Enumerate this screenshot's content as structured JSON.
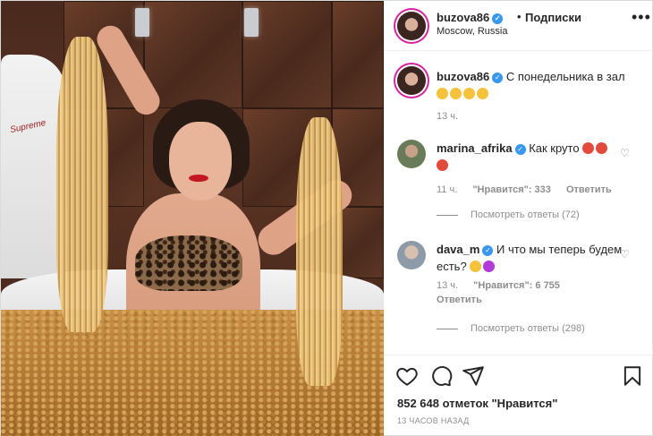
{
  "post": {
    "author": "buzova86",
    "follow_label": "Подписки",
    "location": "Moscow, Russia",
    "more_label": "•••",
    "caption": {
      "text": "С понедельника в зал",
      "time": "13 ч."
    },
    "likes_text": "852 648 отметок \"Нравится\"",
    "timestamp": "13 часов назад"
  },
  "comments": [
    {
      "username": "marina_afrika",
      "text": "Как круто",
      "time": "11 ч.",
      "likes": "\"Нравится\": 333",
      "reply_label": "Ответить",
      "view_replies": "Посмотреть ответы (72)"
    },
    {
      "username": "dava_m",
      "text": "И что мы теперь будем есть?",
      "time": "13 ч.",
      "likes": "\"Нравится\": 6 755",
      "reply_label": "Ответить",
      "view_replies": "Посмотреть ответы (298)"
    }
  ],
  "photo_text": {
    "robe_logo": "Supreme"
  },
  "icons": {
    "like": "heart-icon",
    "comment": "comment-icon",
    "share": "share-icon",
    "save": "bookmark-icon",
    "verified": "verified-badge-icon"
  },
  "colors": {
    "verified": "#3897f0",
    "story_ring": "#d6249f",
    "secondary_text": "#8e8e8e"
  }
}
